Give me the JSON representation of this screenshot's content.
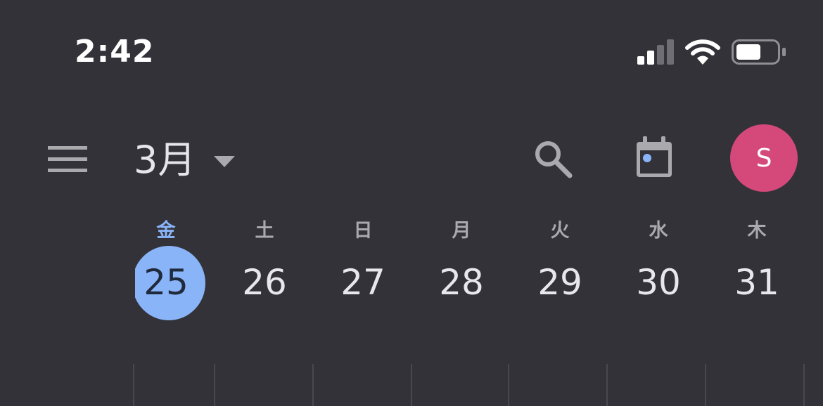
{
  "status_bar": {
    "time": "2:42",
    "signal_icon": "cellular-signal-icon",
    "wifi_icon": "wifi-icon",
    "battery_icon": "battery-icon",
    "battery_level": 0.6
  },
  "header": {
    "menu_icon": "hamburger-menu-icon",
    "month": "3月",
    "dropdown_icon": "caret-down-icon",
    "search_icon": "search-icon",
    "today_icon": "calendar-today-icon",
    "avatar_initial": "S",
    "avatar_color": "#d4497a"
  },
  "week": {
    "days": [
      {
        "weekday": "金",
        "date": "25",
        "selected": true
      },
      {
        "weekday": "土",
        "date": "26",
        "selected": false
      },
      {
        "weekday": "日",
        "date": "27",
        "selected": false
      },
      {
        "weekday": "月",
        "date": "28",
        "selected": false
      },
      {
        "weekday": "火",
        "date": "29",
        "selected": false
      },
      {
        "weekday": "水",
        "date": "30",
        "selected": false
      },
      {
        "weekday": "木",
        "date": "31",
        "selected": false
      }
    ]
  },
  "colors": {
    "background": "#333238",
    "accent": "#8ab4f8",
    "avatar": "#d4497a",
    "text_primary": "#e8e8ec",
    "text_secondary": "#a9a9ae"
  }
}
